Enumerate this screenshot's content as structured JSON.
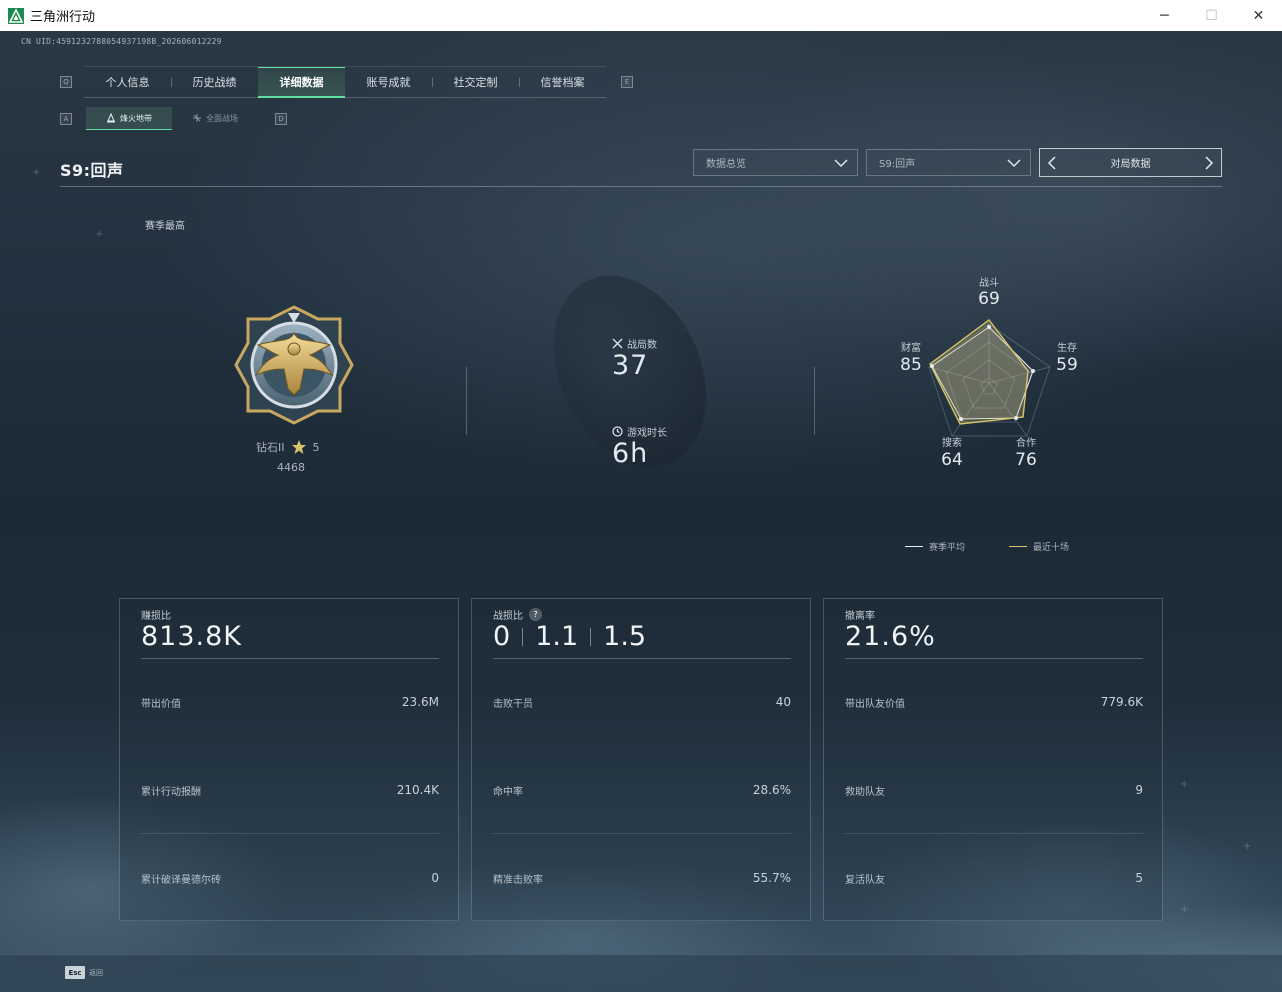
{
  "window": {
    "title": "三角洲行动",
    "minimize": "─",
    "maximize": "☐",
    "close": "✕"
  },
  "uid": "CN UID:4591232788054937198B_202606012229",
  "keyhints": {
    "tabs_left": "Q",
    "tabs_right": "E",
    "sub_left": "A",
    "sub_right": "D"
  },
  "tabs": [
    {
      "label": "个人信息",
      "active": false
    },
    {
      "label": "历史战绩",
      "active": false
    },
    {
      "label": "详细数据",
      "active": true
    },
    {
      "label": "账号成就",
      "active": false
    },
    {
      "label": "社交定制",
      "active": false
    },
    {
      "label": "信誉档案",
      "active": false
    }
  ],
  "subtabs": [
    {
      "label": "烽火地带",
      "active": true,
      "icon": "fire-zone-icon"
    },
    {
      "label": "全面战场",
      "active": false,
      "icon": "battlefield-icon"
    }
  ],
  "season": "S9:回声",
  "filters": {
    "category": "数据总览",
    "season": "S9:回声",
    "pager_label": "对局数据"
  },
  "season_best_label": "赛季最高",
  "rank": {
    "name": "钻石II",
    "stars": "5",
    "points": "4468",
    "medal_numeral": "II"
  },
  "matches": {
    "label": "战局数",
    "value": "37"
  },
  "playtime": {
    "label": "游戏时长",
    "value": "6h"
  },
  "radar": {
    "combat": {
      "label": "战斗",
      "value": "69"
    },
    "survival": {
      "label": "生存",
      "value": "59"
    },
    "cooperation": {
      "label": "合作",
      "value": "76"
    },
    "search": {
      "label": "搜索",
      "value": "64"
    },
    "wealth": {
      "label": "财富",
      "value": "85"
    },
    "legend": [
      {
        "label": "赛季平均",
        "color": "#e6ebee"
      },
      {
        "label": "最近十场",
        "color": "#d8c36a"
      }
    ]
  },
  "cards": [
    {
      "title": "赚损比",
      "value": "813.8K",
      "rows": [
        {
          "label": "带出价值",
          "value": "23.6M"
        },
        {
          "label": "累计行动报酬",
          "value": "210.4K"
        },
        {
          "label": "累计破译曼德尔砖",
          "value": "0"
        }
      ]
    },
    {
      "title": "战损比",
      "ratios": [
        "0",
        "1.1",
        "1.5"
      ],
      "help": "?",
      "rows": [
        {
          "label": "击败干员",
          "value": "40"
        },
        {
          "label": "命中率",
          "value": "28.6%"
        },
        {
          "label": "精准击败率",
          "value": "55.7%"
        }
      ]
    },
    {
      "title": "撤离率",
      "value": "21.6%",
      "rows": [
        {
          "label": "带出队友价值",
          "value": "779.6K"
        },
        {
          "label": "救助队友",
          "value": "9"
        },
        {
          "label": "复活队友",
          "value": "5"
        }
      ]
    }
  ],
  "footer": {
    "esc_key": "Esc",
    "esc_label": "返回"
  },
  "colors": {
    "accent": "#5fe0a2",
    "gold": "#d8c36a"
  }
}
